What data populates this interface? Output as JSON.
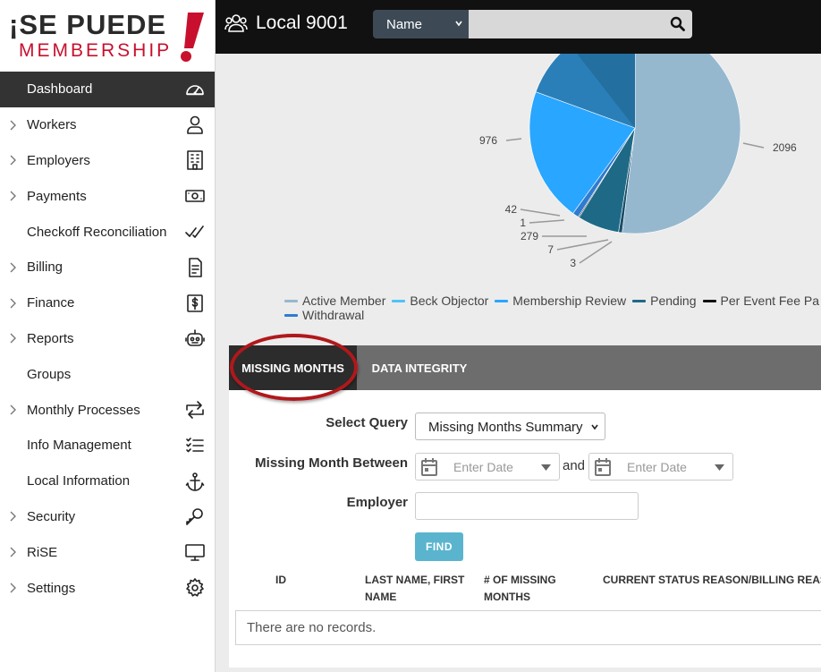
{
  "brand": {
    "line1": "¡SE PUEDE",
    "line2": "MEMBERSHIP"
  },
  "sidebar": {
    "items": [
      {
        "label": "Dashboard",
        "icon": "speedometer-icon",
        "chevron": false,
        "active": true
      },
      {
        "label": "Workers",
        "icon": "user-icon",
        "chevron": true
      },
      {
        "label": "Employers",
        "icon": "building-icon",
        "chevron": true
      },
      {
        "label": "Payments",
        "icon": "cash-icon",
        "chevron": true
      },
      {
        "label": "Checkoff Reconciliation",
        "icon": "double-check-icon",
        "chevron": false
      },
      {
        "label": "Billing",
        "icon": "invoice-icon",
        "chevron": true
      },
      {
        "label": "Finance",
        "icon": "dollar-icon",
        "chevron": true
      },
      {
        "label": "Reports",
        "icon": "robot-icon",
        "chevron": true
      },
      {
        "label": "Groups",
        "icon": "",
        "chevron": false
      },
      {
        "label": "Monthly Processes",
        "icon": "repeat-icon",
        "chevron": true
      },
      {
        "label": "Info Management",
        "icon": "checklist-icon",
        "chevron": false
      },
      {
        "label": "Local Information",
        "icon": "anchor-icon",
        "chevron": false
      },
      {
        "label": "Security",
        "icon": "key-icon",
        "chevron": true
      },
      {
        "label": "RiSE",
        "icon": "monitor-icon",
        "chevron": true
      },
      {
        "label": "Settings",
        "icon": "gear-icon",
        "chevron": true
      }
    ]
  },
  "topbar": {
    "title": "Local 9001",
    "search_field_select": "Name",
    "search_placeholder": ""
  },
  "chart_data": {
    "type": "pie",
    "title": "",
    "slices": [
      {
        "label": "Active Member",
        "value": 2096,
        "color": "#96b8cf"
      },
      {
        "label": "Beck Objector",
        "value": 3,
        "color": "#4fc3f7"
      },
      {
        "label": "Membership Review",
        "value": 976,
        "color": "#29a6ff"
      },
      {
        "label": "Pending",
        "value": 279,
        "color": "#1e6a86"
      },
      {
        "label": "Per Event Fee Payer",
        "value": 1,
        "color": "#111111"
      },
      {
        "label": "Withdrawal",
        "value": 42,
        "color": "#2f7bd0"
      },
      {
        "label": "",
        "value": 7,
        "color": "#1a4f6b"
      }
    ],
    "data_labels": [
      "2096",
      "976",
      "42",
      "1",
      "279",
      "7",
      "3"
    ],
    "legend": [
      {
        "label": "Active Member",
        "color": "#96b8cf"
      },
      {
        "label": "Beck Objector",
        "color": "#4fc3f7"
      },
      {
        "label": "Membership Review",
        "color": "#29a6ff"
      },
      {
        "label": "Pending",
        "color": "#1e6a86"
      },
      {
        "label": "Per Event Fee Pa",
        "color": "#111111"
      },
      {
        "label": "Withdrawal",
        "color": "#2f7bd0"
      }
    ],
    "legend_position": "bottom"
  },
  "panel": {
    "tabs": [
      {
        "label": "MISSING MONTHS",
        "active": true
      },
      {
        "label": "DATA INTEGRITY",
        "active": false
      }
    ],
    "select_query_label": "Select Query",
    "select_query_value": "Missing Months Summary",
    "missing_between_label": "Missing Month Between",
    "date_placeholder": "Enter Date",
    "and_label": "and",
    "employer_label": "Employer",
    "employer_value": "",
    "find_label": "FIND",
    "table_headers": [
      "ID",
      "LAST NAME, FIRST NAME",
      "# OF MISSING MONTHS",
      "CURRENT STATUS REASON/BILLING REAS"
    ],
    "empty_message": "There are no records."
  },
  "colors": {
    "sidebar_active_bg": "#333333",
    "topbar_bg": "#111111",
    "brand_red": "#c8102e",
    "find_button": "#5bb4ce",
    "highlight_ring": "#b0181b"
  }
}
